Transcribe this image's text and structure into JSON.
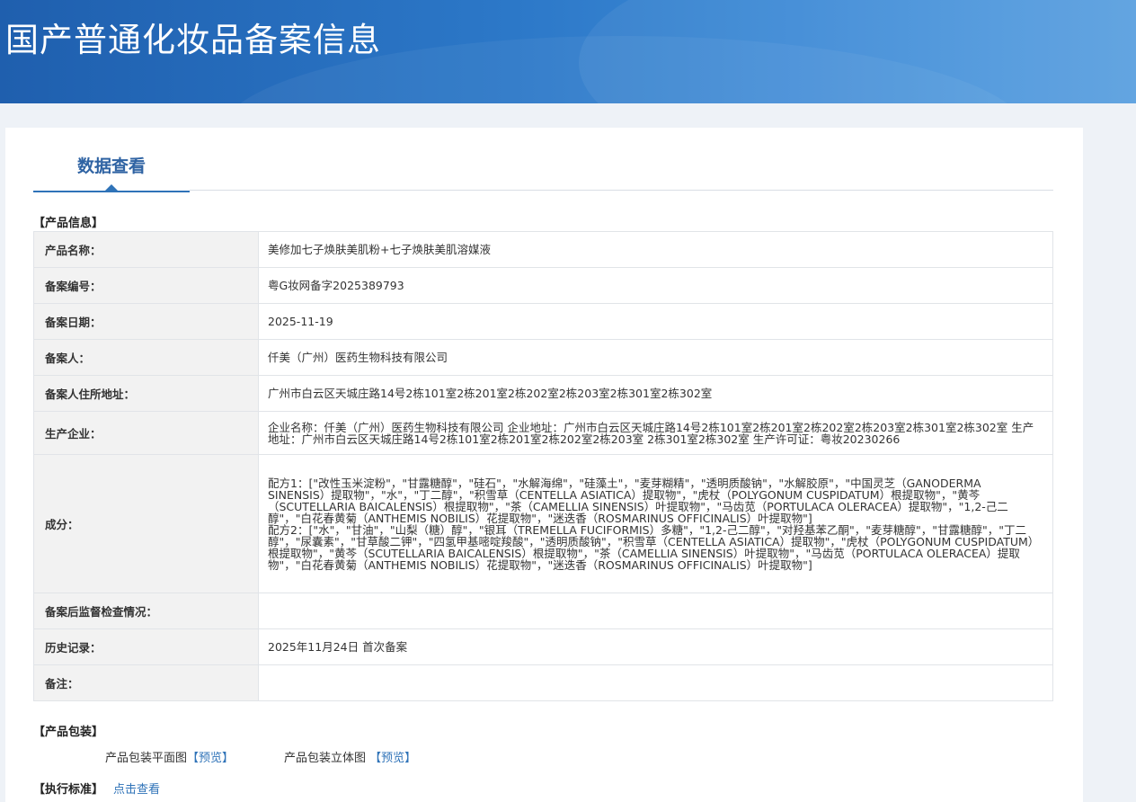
{
  "header": {
    "title": "国产普通化妆品备案信息"
  },
  "tabs": [
    {
      "label": "数据查看"
    }
  ],
  "product_info": {
    "section_title": "【产品信息】",
    "rows": [
      {
        "label": "产品名称：",
        "value": "美修加七子焕肤美肌粉+七子焕肤美肌溶媒液"
      },
      {
        "label": "备案编号：",
        "value": "粤G妆网备字2025389793"
      },
      {
        "label": "备案日期：",
        "value": "2025-11-19"
      },
      {
        "label": "备案人：",
        "value": "仟美（广州）医药生物科技有限公司"
      },
      {
        "label": "备案人住所地址：",
        "value": "广州市白云区天城庄路14号2栋101室2栋201室2栋202室2栋203室2栋301室2栋302室"
      },
      {
        "label": "生产企业：",
        "value": "企业名称：仟美（广州）医药生物科技有限公司 企业地址：广州市白云区天城庄路14号2栋101室2栋201室2栋202室2栋203室2栋301室2栋302室 生产地址：广州市白云区天城庄路14号2栋101室2栋201室2栋202室2栋203室 2栋301室2栋302室 生产许可证：粤妆20230266"
      },
      {
        "label": "成分：",
        "value": "配方1：[\"改性玉米淀粉\"，\"甘露糖醇\"，\"硅石\"，\"水解海绵\"，\"硅藻土\"，\"麦芽糊精\"，\"透明质酸钠\"，\"水解胶原\"，\"中国灵芝（GANODERMA SINENSIS）提取物\"，\"水\"，\"丁二醇\"，\"积雪草（CENTELLA ASIATICA）提取物\"，\"虎杖（POLYGONUM CUSPIDATUM）根提取物\"，\"黄芩（SCUTELLARIA BAICALENSIS）根提取物\"，\"茶（CAMELLIA SINENSIS）叶提取物\"，\"马齿苋（PORTULACA OLERACEA）提取物\"，\"1,2-己二醇\"，\"白花春黄菊（ANTHEMIS NOBILIS）花提取物\"，\"迷迭香（ROSMARINUS OFFICINALIS）叶提取物\"]\n配方2：[\"水\"，\"甘油\"，\"山梨（糖）醇\"，\"银耳（TREMELLA FUCIFORMIS）多糖\"，\"1,2-己二醇\"，\"对羟基苯乙酮\"，\"麦芽糖醇\"，\"甘露糖醇\"，\"丁二醇\"，\"尿囊素\"，\"甘草酸二钾\"，\"四氢甲基嘧啶羧酸\"，\"透明质酸钠\"，\"积雪草（CENTELLA ASIATICA）提取物\"，\"虎杖（POLYGONUM CUSPIDATUM）根提取物\"，\"黄芩（SCUTELLARIA BAICALENSIS）根提取物\"，\"茶（CAMELLIA SINENSIS）叶提取物\"，\"马齿苋（PORTULACA OLERACEA）提取物\"，\"白花春黄菊（ANTHEMIS NOBILIS）花提取物\"，\"迷迭香（ROSMARINUS OFFICINALIS）叶提取物\"]"
      },
      {
        "label": "备案后监督检查情况：",
        "value": ""
      },
      {
        "label": "历史记录：",
        "value": "2025年11月24日 首次备案"
      },
      {
        "label": "备注：",
        "value": ""
      }
    ]
  },
  "packaging": {
    "section_title": "【产品包装】",
    "flat_label": "产品包装平面图",
    "flat_link": "【预览】",
    "solid_label": "产品包装立体图",
    "solid_link": "【预览】"
  },
  "standard": {
    "section_title": "【执行标准】",
    "link": "点击查看"
  },
  "colors": {
    "banner": "#2c78c8",
    "tab_text": "#2f63a3",
    "link": "#2f73b8",
    "label_bg": "#f2f2f2"
  }
}
